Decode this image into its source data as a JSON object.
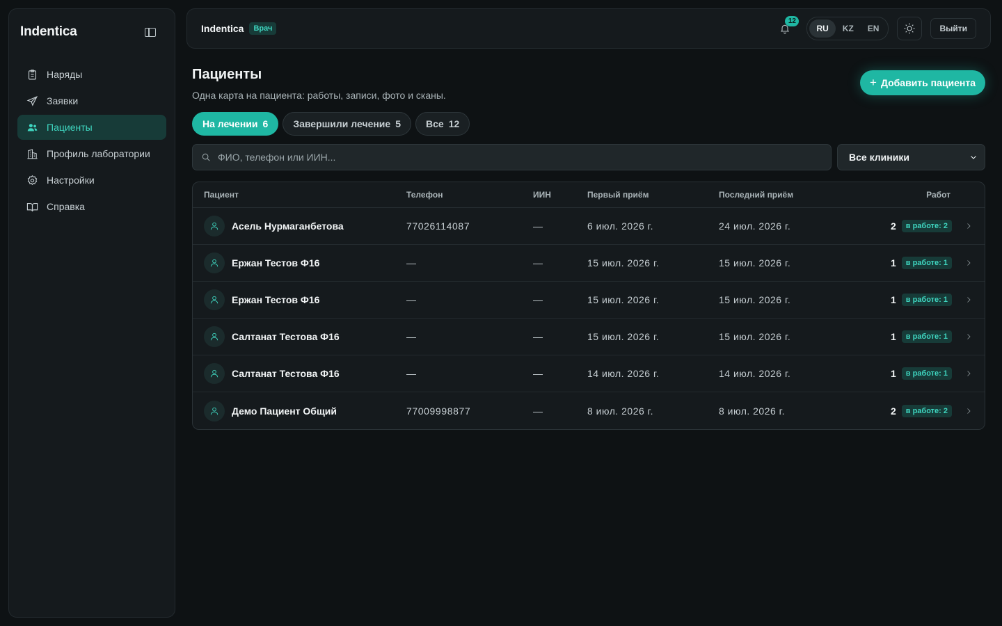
{
  "app": {
    "brand": "Indentica"
  },
  "sidebar": {
    "items": [
      {
        "label": "Наряды",
        "icon": "clipboard-icon",
        "active": false
      },
      {
        "label": "Заявки",
        "icon": "send-icon",
        "active": false
      },
      {
        "label": "Пациенты",
        "icon": "users-icon",
        "active": true
      },
      {
        "label": "Профиль лаборатории",
        "icon": "building-icon",
        "active": false
      },
      {
        "label": "Настройки",
        "icon": "gear-icon",
        "active": false
      },
      {
        "label": "Справка",
        "icon": "book-icon",
        "active": false
      }
    ]
  },
  "topbar": {
    "brand": "Indentica",
    "role": "Врач",
    "notifications": "12",
    "languages": [
      "RU",
      "KZ",
      "EN"
    ],
    "active_language": "RU",
    "logout": "Выйти"
  },
  "page": {
    "title": "Пациенты",
    "subtitle": "Одна карта на пациента: работы, записи, фото и сканы.",
    "add_button": "Добавить пациента"
  },
  "tabs": [
    {
      "label": "На лечении",
      "count": "6",
      "active": true
    },
    {
      "label": "Завершили лечение",
      "count": "5",
      "active": false
    },
    {
      "label": "Все",
      "count": "12",
      "active": false
    }
  ],
  "search": {
    "placeholder": "ФИО, телефон или ИИН..."
  },
  "clinic_filter": {
    "value": "Все клиники"
  },
  "table": {
    "headers": {
      "patient": "Пациент",
      "phone": "Телефон",
      "iin": "ИИН",
      "first": "Первый приём",
      "last": "Последний приём",
      "works": "Работ"
    },
    "rows": [
      {
        "name": "Асель Нурмаганбетова",
        "phone": "77026114087",
        "iin": "—",
        "first": "6 июл. 2026 г.",
        "last": "24 июл. 2026 г.",
        "works": "2",
        "badge": "в работе: 2"
      },
      {
        "name": "Ержан Тестов Ф16",
        "phone": "—",
        "iin": "—",
        "first": "15 июл. 2026 г.",
        "last": "15 июл. 2026 г.",
        "works": "1",
        "badge": "в работе: 1"
      },
      {
        "name": "Ержан Тестов Ф16",
        "phone": "—",
        "iin": "—",
        "first": "15 июл. 2026 г.",
        "last": "15 июл. 2026 г.",
        "works": "1",
        "badge": "в работе: 1"
      },
      {
        "name": "Салтанат Тестова Ф16",
        "phone": "—",
        "iin": "—",
        "first": "15 июл. 2026 г.",
        "last": "15 июл. 2026 г.",
        "works": "1",
        "badge": "в работе: 1"
      },
      {
        "name": "Салтанат Тестова Ф16",
        "phone": "—",
        "iin": "—",
        "first": "14 июл. 2026 г.",
        "last": "14 июл. 2026 г.",
        "works": "1",
        "badge": "в работе: 1"
      },
      {
        "name": "Демо Пациент Общий",
        "phone": "77009998877",
        "iin": "—",
        "first": "8 июл. 2026 г.",
        "last": "8 июл. 2026 г.",
        "works": "2",
        "badge": "в работе: 2"
      }
    ]
  }
}
